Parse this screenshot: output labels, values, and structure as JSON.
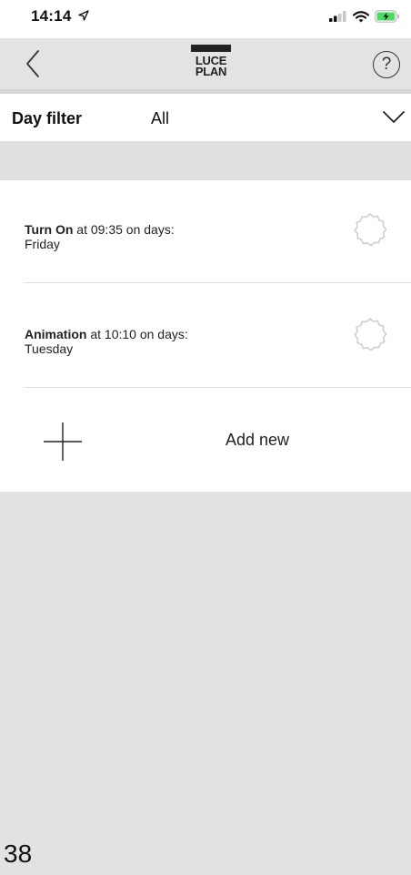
{
  "status_bar": {
    "time": "14:14",
    "location_icon": "location-arrow-icon",
    "signal_icon": "cellular-signal-icon",
    "wifi_icon": "wifi-icon",
    "battery_icon": "battery-charging-icon",
    "battery_color": "#4cd964"
  },
  "nav": {
    "back_icon": "chevron-left-icon",
    "logo_line1": "LUCE",
    "logo_line2": "PLAN",
    "help_label": "?"
  },
  "filter": {
    "label": "Day filter",
    "value": "All",
    "dropdown_icon": "chevron-down-icon"
  },
  "schedules": [
    {
      "action": "Turn On",
      "time_text": "at 09:35 on days:",
      "days": "Friday",
      "icon": "gear-icon"
    },
    {
      "action": "Animation",
      "time_text": "at 10:10 on days:",
      "days": "Tuesday",
      "icon": "gear-icon"
    }
  ],
  "add_new": {
    "label": "Add new",
    "icon": "plus-icon"
  },
  "page_number": "38",
  "colors": {
    "background": "#e2e2e2",
    "panel": "#ffffff",
    "text": "#111111"
  }
}
